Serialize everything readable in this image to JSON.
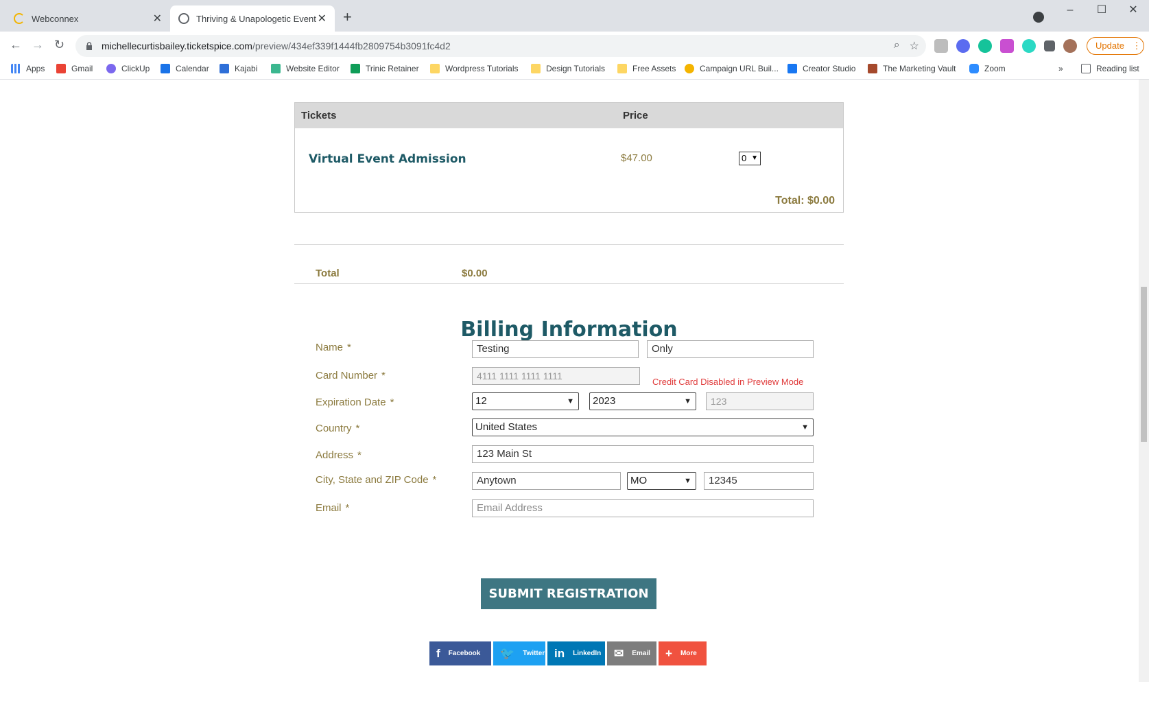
{
  "browser": {
    "tabs": [
      {
        "label": "Webconnex"
      },
      {
        "label": "Thriving & Unapologetic Event"
      }
    ],
    "url_host": "michellecurtisbailey.ticketspice.com",
    "url_path": "/preview/434ef339f1444fb2809754b3091fc4d2",
    "update_label": "Update",
    "bookmarks": [
      {
        "label": "Apps"
      },
      {
        "label": "Gmail"
      },
      {
        "label": "ClickUp"
      },
      {
        "label": "Calendar"
      },
      {
        "label": "Kajabi"
      },
      {
        "label": "Website Editor"
      },
      {
        "label": "Trinic Retainer"
      },
      {
        "label": "Wordpress Tutorials"
      },
      {
        "label": "Design Tutorials"
      },
      {
        "label": "Free Assets"
      },
      {
        "label": "Campaign URL Buil..."
      },
      {
        "label": "Creator Studio"
      },
      {
        "label": "The Marketing Vault"
      },
      {
        "label": "Zoom"
      }
    ],
    "reading_list": "Reading list"
  },
  "tickets": {
    "header_tickets": "Tickets",
    "header_price": "Price",
    "item_name": "Virtual Event Admission",
    "item_price": "$47.00",
    "item_qty": "0",
    "total_line": "Total: $0.00"
  },
  "summary": {
    "total_label": "Total",
    "total_value": "$0.00"
  },
  "billing": {
    "title": "Billing Information",
    "name_label": "Name",
    "first_name": "Testing",
    "last_name": "Only",
    "card_label": "Card Number",
    "card_placeholder": "4111 1111 1111 1111",
    "card_warning": "Credit Card Disabled in Preview Mode",
    "exp_label": "Expiration Date",
    "exp_month": "12",
    "exp_year": "2023",
    "cvv_placeholder": "123",
    "country_label": "Country",
    "country": "United States",
    "address_label": "Address",
    "address": "123 Main St",
    "csz_label": "City, State and ZIP Code",
    "city": "Anytown",
    "state": "MO",
    "zip": "12345",
    "email_label": "Email",
    "email_placeholder": "Email Address",
    "required_mark": "*"
  },
  "submit_label": "SUBMIT REGISTRATION",
  "share": [
    {
      "label": "Facebook",
      "color": "#3b5998"
    },
    {
      "label": "Twitter",
      "color": "#1da1f2"
    },
    {
      "label": "LinkedIn",
      "color": "#0077b5"
    },
    {
      "label": "Email",
      "color": "#7d7d7d"
    },
    {
      "label": "More",
      "color": "#f0523f"
    }
  ]
}
